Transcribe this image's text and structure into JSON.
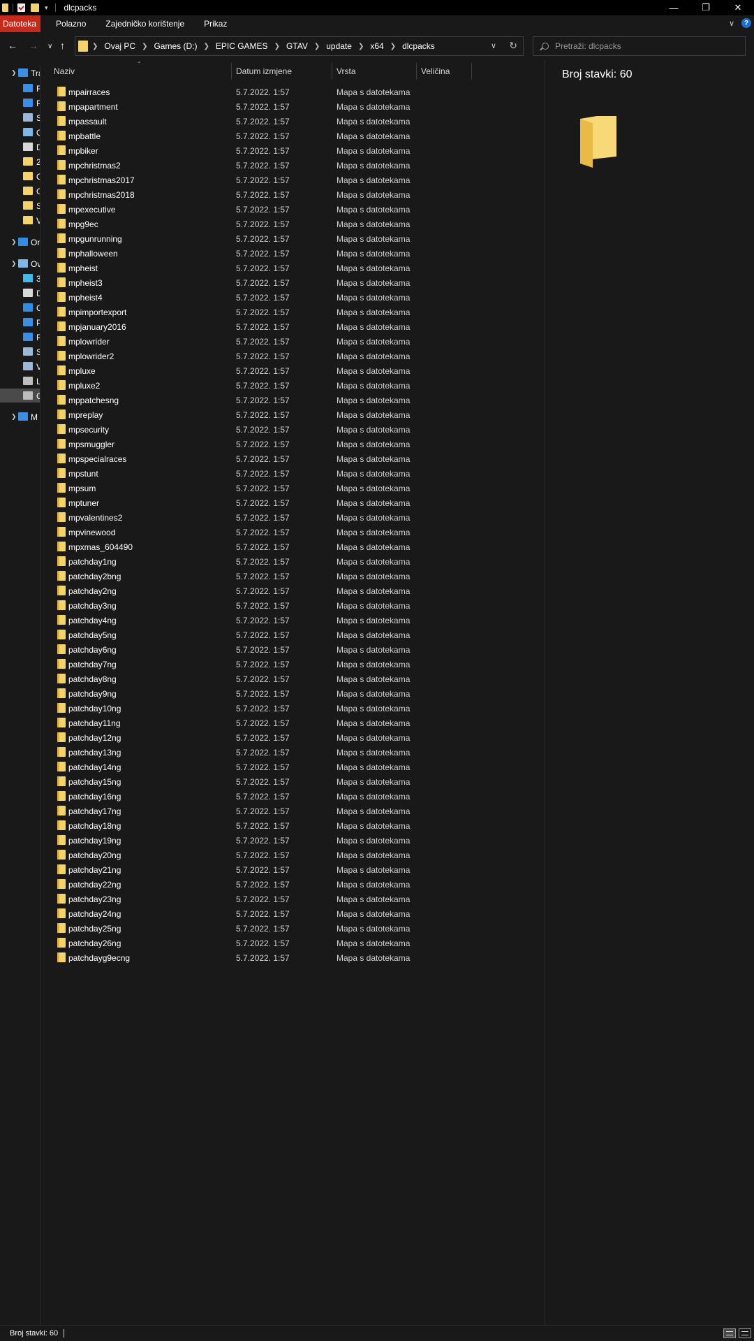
{
  "window": {
    "title": "dlcpacks"
  },
  "ribbon": {
    "tabs": [
      {
        "label": "Datoteka",
        "active": true
      },
      {
        "label": "Polazno",
        "active": false
      },
      {
        "label": "Zajedničko korištenje",
        "active": false
      },
      {
        "label": "Prikaz",
        "active": false
      }
    ]
  },
  "address": {
    "crumbs": [
      "Ovaj PC",
      "Games (D:)",
      "EPIC GAMES",
      "GTAV",
      "update",
      "x64",
      "dlcpacks"
    ]
  },
  "search": {
    "placeholder": "Pretraži: dlcpacks"
  },
  "navpane": {
    "items": [
      {
        "label": "Tra",
        "icon": "star-icon",
        "color": "#3a8ee6",
        "arrow": true
      },
      {
        "label": "R",
        "icon": "desktop-icon",
        "color": "#3a8ee6"
      },
      {
        "label": "P",
        "icon": "download-icon",
        "color": "#3a8ee6"
      },
      {
        "label": "S",
        "icon": "pictures-icon",
        "color": "#9bb8d8"
      },
      {
        "label": "O",
        "icon": "pc-icon",
        "color": "#7fb6e8"
      },
      {
        "label": "D",
        "icon": "document-icon",
        "color": "#d8d8d8"
      },
      {
        "label": "2",
        "icon": "folder-icon",
        "color": "#f5d36b"
      },
      {
        "label": "O",
        "icon": "folder-icon",
        "color": "#f5d36b"
      },
      {
        "label": "G",
        "icon": "folder-icon",
        "color": "#f5d36b"
      },
      {
        "label": "S",
        "icon": "folder-icon",
        "color": "#f5d36b"
      },
      {
        "label": "V",
        "icon": "folder-icon",
        "color": "#f5d36b"
      },
      {
        "label": "On",
        "icon": "onedrive-icon",
        "color": "#2f8de4",
        "arrow": true
      },
      {
        "label": "Ov",
        "icon": "pc-icon",
        "color": "#7fb6e8",
        "arrow": true
      },
      {
        "label": "3",
        "icon": "3d-objects-icon",
        "color": "#41b8e8"
      },
      {
        "label": "D",
        "icon": "document-icon",
        "color": "#d8d8d8"
      },
      {
        "label": "G",
        "icon": "music-icon",
        "color": "#2f8de4"
      },
      {
        "label": "P",
        "icon": "download-icon",
        "color": "#3a8ee6"
      },
      {
        "label": "R",
        "icon": "desktop-icon",
        "color": "#3a8ee6"
      },
      {
        "label": "S",
        "icon": "pictures-icon",
        "color": "#9bb8d8"
      },
      {
        "label": "V",
        "icon": "videos-icon",
        "color": "#9bb8d8"
      },
      {
        "label": "L",
        "icon": "drive-icon",
        "color": "#bdbdbd"
      },
      {
        "label": "G",
        "icon": "drive-icon",
        "color": "#bdbdbd",
        "selected": true
      },
      {
        "label": "M",
        "icon": "network-icon",
        "color": "#3a8ee6",
        "arrow": true
      }
    ]
  },
  "columns": {
    "name": "Naziv",
    "date": "Datum izmjene",
    "type": "Vrsta",
    "size": "Veličina"
  },
  "files": [
    {
      "name": "mpairraces",
      "date": "5.7.2022. 1:57",
      "type": "Mapa s datotekama"
    },
    {
      "name": "mpapartment",
      "date": "5.7.2022. 1:57",
      "type": "Mapa s datotekama"
    },
    {
      "name": "mpassault",
      "date": "5.7.2022. 1:57",
      "type": "Mapa s datotekama"
    },
    {
      "name": "mpbattle",
      "date": "5.7.2022. 1:57",
      "type": "Mapa s datotekama"
    },
    {
      "name": "mpbiker",
      "date": "5.7.2022. 1:57",
      "type": "Mapa s datotekama"
    },
    {
      "name": "mpchristmas2",
      "date": "5.7.2022. 1:57",
      "type": "Mapa s datotekama"
    },
    {
      "name": "mpchristmas2017",
      "date": "5.7.2022. 1:57",
      "type": "Mapa s datotekama"
    },
    {
      "name": "mpchristmas2018",
      "date": "5.7.2022. 1:57",
      "type": "Mapa s datotekama"
    },
    {
      "name": "mpexecutive",
      "date": "5.7.2022. 1:57",
      "type": "Mapa s datotekama"
    },
    {
      "name": "mpg9ec",
      "date": "5.7.2022. 1:57",
      "type": "Mapa s datotekama"
    },
    {
      "name": "mpgunrunning",
      "date": "5.7.2022. 1:57",
      "type": "Mapa s datotekama"
    },
    {
      "name": "mphalloween",
      "date": "5.7.2022. 1:57",
      "type": "Mapa s datotekama"
    },
    {
      "name": "mpheist",
      "date": "5.7.2022. 1:57",
      "type": "Mapa s datotekama"
    },
    {
      "name": "mpheist3",
      "date": "5.7.2022. 1:57",
      "type": "Mapa s datotekama"
    },
    {
      "name": "mpheist4",
      "date": "5.7.2022. 1:57",
      "type": "Mapa s datotekama"
    },
    {
      "name": "mpimportexport",
      "date": "5.7.2022. 1:57",
      "type": "Mapa s datotekama"
    },
    {
      "name": "mpjanuary2016",
      "date": "5.7.2022. 1:57",
      "type": "Mapa s datotekama"
    },
    {
      "name": "mplowrider",
      "date": "5.7.2022. 1:57",
      "type": "Mapa s datotekama"
    },
    {
      "name": "mplowrider2",
      "date": "5.7.2022. 1:57",
      "type": "Mapa s datotekama"
    },
    {
      "name": "mpluxe",
      "date": "5.7.2022. 1:57",
      "type": "Mapa s datotekama"
    },
    {
      "name": "mpluxe2",
      "date": "5.7.2022. 1:57",
      "type": "Mapa s datotekama"
    },
    {
      "name": "mppatchesng",
      "date": "5.7.2022. 1:57",
      "type": "Mapa s datotekama"
    },
    {
      "name": "mpreplay",
      "date": "5.7.2022. 1:57",
      "type": "Mapa s datotekama"
    },
    {
      "name": "mpsecurity",
      "date": "5.7.2022. 1:57",
      "type": "Mapa s datotekama"
    },
    {
      "name": "mpsmuggler",
      "date": "5.7.2022. 1:57",
      "type": "Mapa s datotekama"
    },
    {
      "name": "mpspecialraces",
      "date": "5.7.2022. 1:57",
      "type": "Mapa s datotekama"
    },
    {
      "name": "mpstunt",
      "date": "5.7.2022. 1:57",
      "type": "Mapa s datotekama"
    },
    {
      "name": "mpsum",
      "date": "5.7.2022. 1:57",
      "type": "Mapa s datotekama"
    },
    {
      "name": "mptuner",
      "date": "5.7.2022. 1:57",
      "type": "Mapa s datotekama"
    },
    {
      "name": "mpvalentines2",
      "date": "5.7.2022. 1:57",
      "type": "Mapa s datotekama"
    },
    {
      "name": "mpvinewood",
      "date": "5.7.2022. 1:57",
      "type": "Mapa s datotekama"
    },
    {
      "name": "mpxmas_604490",
      "date": "5.7.2022. 1:57",
      "type": "Mapa s datotekama"
    },
    {
      "name": "patchday1ng",
      "date": "5.7.2022. 1:57",
      "type": "Mapa s datotekama"
    },
    {
      "name": "patchday2bng",
      "date": "5.7.2022. 1:57",
      "type": "Mapa s datotekama"
    },
    {
      "name": "patchday2ng",
      "date": "5.7.2022. 1:57",
      "type": "Mapa s datotekama"
    },
    {
      "name": "patchday3ng",
      "date": "5.7.2022. 1:57",
      "type": "Mapa s datotekama"
    },
    {
      "name": "patchday4ng",
      "date": "5.7.2022. 1:57",
      "type": "Mapa s datotekama"
    },
    {
      "name": "patchday5ng",
      "date": "5.7.2022. 1:57",
      "type": "Mapa s datotekama"
    },
    {
      "name": "patchday6ng",
      "date": "5.7.2022. 1:57",
      "type": "Mapa s datotekama"
    },
    {
      "name": "patchday7ng",
      "date": "5.7.2022. 1:57",
      "type": "Mapa s datotekama"
    },
    {
      "name": "patchday8ng",
      "date": "5.7.2022. 1:57",
      "type": "Mapa s datotekama"
    },
    {
      "name": "patchday9ng",
      "date": "5.7.2022. 1:57",
      "type": "Mapa s datotekama"
    },
    {
      "name": "patchday10ng",
      "date": "5.7.2022. 1:57",
      "type": "Mapa s datotekama"
    },
    {
      "name": "patchday11ng",
      "date": "5.7.2022. 1:57",
      "type": "Mapa s datotekama"
    },
    {
      "name": "patchday12ng",
      "date": "5.7.2022. 1:57",
      "type": "Mapa s datotekama"
    },
    {
      "name": "patchday13ng",
      "date": "5.7.2022. 1:57",
      "type": "Mapa s datotekama"
    },
    {
      "name": "patchday14ng",
      "date": "5.7.2022. 1:57",
      "type": "Mapa s datotekama"
    },
    {
      "name": "patchday15ng",
      "date": "5.7.2022. 1:57",
      "type": "Mapa s datotekama"
    },
    {
      "name": "patchday16ng",
      "date": "5.7.2022. 1:57",
      "type": "Mapa s datotekama"
    },
    {
      "name": "patchday17ng",
      "date": "5.7.2022. 1:57",
      "type": "Mapa s datotekama"
    },
    {
      "name": "patchday18ng",
      "date": "5.7.2022. 1:57",
      "type": "Mapa s datotekama"
    },
    {
      "name": "patchday19ng",
      "date": "5.7.2022. 1:57",
      "type": "Mapa s datotekama"
    },
    {
      "name": "patchday20ng",
      "date": "5.7.2022. 1:57",
      "type": "Mapa s datotekama"
    },
    {
      "name": "patchday21ng",
      "date": "5.7.2022. 1:57",
      "type": "Mapa s datotekama"
    },
    {
      "name": "patchday22ng",
      "date": "5.7.2022. 1:57",
      "type": "Mapa s datotekama"
    },
    {
      "name": "patchday23ng",
      "date": "5.7.2022. 1:57",
      "type": "Mapa s datotekama"
    },
    {
      "name": "patchday24ng",
      "date": "5.7.2022. 1:57",
      "type": "Mapa s datotekama"
    },
    {
      "name": "patchday25ng",
      "date": "5.7.2022. 1:57",
      "type": "Mapa s datotekama"
    },
    {
      "name": "patchday26ng",
      "date": "5.7.2022. 1:57",
      "type": "Mapa s datotekama"
    },
    {
      "name": "patchdayg9ecng",
      "date": "5.7.2022. 1:57",
      "type": "Mapa s datotekama"
    }
  ],
  "preview": {
    "count_text": "Broj stavki: 60"
  },
  "status": {
    "count_text": "Broj stavki: 60"
  },
  "colors": {
    "accent_tab": "#c42b1c",
    "folder": "#f5d36b",
    "background": "#191919"
  }
}
